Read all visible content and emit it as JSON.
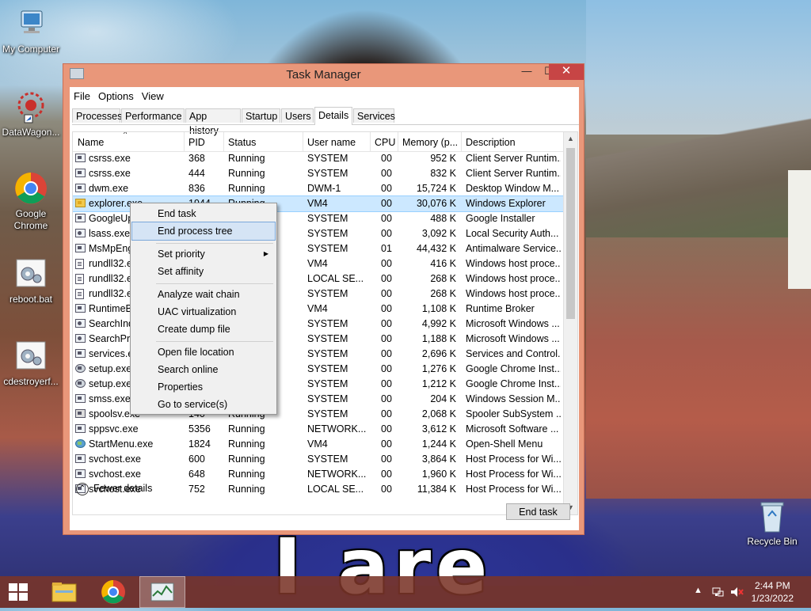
{
  "desktop": {
    "icons": [
      {
        "label": "My Computer"
      },
      {
        "label": "DataWagon..."
      },
      {
        "label": "Google Chrome"
      },
      {
        "label": "reboot.bat"
      },
      {
        "label": "cdestroyerf..."
      },
      {
        "label": "Recycle Bin"
      }
    ],
    "caption": "I are"
  },
  "window": {
    "title": "Task Manager",
    "controls": {
      "minimize": "—",
      "maximize": "☐",
      "close": "✕"
    },
    "menu": [
      "File",
      "Options",
      "View"
    ],
    "tabs": [
      "Processes",
      "Performance",
      "App history",
      "Startup",
      "Users",
      "Details",
      "Services"
    ],
    "active_tab": "Details",
    "columns": [
      "Name",
      "PID",
      "Status",
      "User name",
      "CPU",
      "Memory (p...",
      "Description"
    ],
    "rows": [
      {
        "name": "csrss.exe",
        "pid": "368",
        "status": "Running",
        "user": "SYSTEM",
        "cpu": "00",
        "mem": "952 K",
        "desc": "Client Server Runtim..."
      },
      {
        "name": "csrss.exe",
        "pid": "444",
        "status": "Running",
        "user": "SYSTEM",
        "cpu": "00",
        "mem": "832 K",
        "desc": "Client Server Runtim..."
      },
      {
        "name": "dwm.exe",
        "pid": "836",
        "status": "Running",
        "user": "DWM-1",
        "cpu": "00",
        "mem": "15,724 K",
        "desc": "Desktop Window M..."
      },
      {
        "name": "explorer.exe",
        "pid": "1944",
        "status": "Running",
        "user": "VM4",
        "cpu": "00",
        "mem": "30,076 K",
        "desc": "Windows Explorer"
      },
      {
        "name": "GoogleUpdate.exe",
        "pid": "",
        "status": "",
        "user": "SYSTEM",
        "cpu": "00",
        "mem": "488 K",
        "desc": "Google Installer"
      },
      {
        "name": "lsass.exe",
        "pid": "",
        "status": "",
        "user": "SYSTEM",
        "cpu": "00",
        "mem": "3,092 K",
        "desc": "Local Security Auth..."
      },
      {
        "name": "MsMpEng.exe",
        "pid": "",
        "status": "",
        "user": "SYSTEM",
        "cpu": "01",
        "mem": "44,432 K",
        "desc": "Antimalware Service..."
      },
      {
        "name": "rundll32.exe",
        "pid": "",
        "status": "",
        "user": "VM4",
        "cpu": "00",
        "mem": "416 K",
        "desc": "Windows host proce..."
      },
      {
        "name": "rundll32.exe",
        "pid": "",
        "status": "",
        "user": "LOCAL SE...",
        "cpu": "00",
        "mem": "268 K",
        "desc": "Windows host proce..."
      },
      {
        "name": "rundll32.exe",
        "pid": "",
        "status": "",
        "user": "SYSTEM",
        "cpu": "00",
        "mem": "268 K",
        "desc": "Windows host proce..."
      },
      {
        "name": "RuntimeBroker.exe",
        "pid": "",
        "status": "",
        "user": "VM4",
        "cpu": "00",
        "mem": "1,108 K",
        "desc": "Runtime Broker"
      },
      {
        "name": "SearchIndexer.exe",
        "pid": "",
        "status": "",
        "user": "SYSTEM",
        "cpu": "00",
        "mem": "4,992 K",
        "desc": "Microsoft Windows ..."
      },
      {
        "name": "SearchProtocolHost.exe",
        "pid": "",
        "status": "",
        "user": "SYSTEM",
        "cpu": "00",
        "mem": "1,188 K",
        "desc": "Microsoft Windows ..."
      },
      {
        "name": "services.exe",
        "pid": "",
        "status": "",
        "user": "SYSTEM",
        "cpu": "00",
        "mem": "2,696 K",
        "desc": "Services and Control..."
      },
      {
        "name": "setup.exe",
        "pid": "",
        "status": "",
        "user": "SYSTEM",
        "cpu": "00",
        "mem": "1,276 K",
        "desc": "Google Chrome Inst..."
      },
      {
        "name": "setup.exe",
        "pid": "",
        "status": "",
        "user": "SYSTEM",
        "cpu": "00",
        "mem": "1,212 K",
        "desc": "Google Chrome Inst..."
      },
      {
        "name": "smss.exe",
        "pid": "",
        "status": "",
        "user": "SYSTEM",
        "cpu": "00",
        "mem": "204 K",
        "desc": "Windows Session M..."
      },
      {
        "name": "spoolsv.exe",
        "pid": "140",
        "status": "Running",
        "user": "SYSTEM",
        "cpu": "00",
        "mem": "2,068 K",
        "desc": "Spooler SubSystem ..."
      },
      {
        "name": "sppsvc.exe",
        "pid": "5356",
        "status": "Running",
        "user": "NETWORK...",
        "cpu": "00",
        "mem": "3,612 K",
        "desc": "Microsoft Software ..."
      },
      {
        "name": "StartMenu.exe",
        "pid": "1824",
        "status": "Running",
        "user": "VM4",
        "cpu": "00",
        "mem": "1,244 K",
        "desc": "Open-Shell Menu"
      },
      {
        "name": "svchost.exe",
        "pid": "600",
        "status": "Running",
        "user": "SYSTEM",
        "cpu": "00",
        "mem": "3,864 K",
        "desc": "Host Process for Wi..."
      },
      {
        "name": "svchost.exe",
        "pid": "648",
        "status": "Running",
        "user": "NETWORK...",
        "cpu": "00",
        "mem": "1,960 K",
        "desc": "Host Process for Wi..."
      },
      {
        "name": "svchost.exe",
        "pid": "752",
        "status": "Running",
        "user": "LOCAL SE...",
        "cpu": "00",
        "mem": "11,384 K",
        "desc": "Host Process for Wi..."
      }
    ],
    "fewer_details": "Fewer details",
    "end_task": "End task"
  },
  "context_menu": {
    "items": [
      "End task",
      "End process tree",
      "Set priority",
      "Set affinity",
      "Analyze wait chain",
      "UAC virtualization",
      "Create dump file",
      "Open file location",
      "Search online",
      "Properties",
      "Go to service(s)"
    ],
    "submenu_arrow": "▶"
  },
  "taskbar": {
    "time": "2:44 PM",
    "date": "1/23/2022",
    "tray_arrow": "▲"
  },
  "colors": {
    "window_frame": "#e9977a",
    "close_button": "#c74545",
    "selection": "#cce8ff",
    "menu_highlight": "#d5e4f5",
    "taskbar": "#7a3428"
  }
}
